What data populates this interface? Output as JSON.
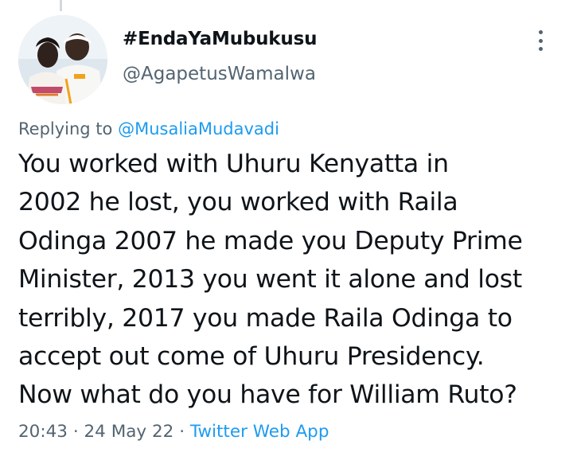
{
  "author": {
    "display_name": "#EndaYaMubukusu",
    "handle": "@AgapetusWamalwa"
  },
  "reply": {
    "prefix": "Replying to",
    "to": "@MusaliaMudavadi"
  },
  "tweet": {
    "lines": [
      "You worked with Uhuru Kenyatta in",
      "2002 he lost, you worked with Raila",
      "Odinga 2007 he made you Deputy Prime",
      "Minister, 2013 you went it alone and lost",
      "terribly, 2017 you made Raila Odinga to",
      "accept out come of Uhuru Presidency.",
      "Now what do you have for William Ruto?"
    ]
  },
  "meta": {
    "time": "20:43",
    "separator_1": "·",
    "date": "24 May 22",
    "separator_2": "·",
    "source": "Twitter Web App"
  },
  "icons": {
    "more": "more-options-icon"
  },
  "colors": {
    "text": "#0f1419",
    "secondary": "#536471",
    "link": "#1d9bf0",
    "background": "#ffffff"
  }
}
